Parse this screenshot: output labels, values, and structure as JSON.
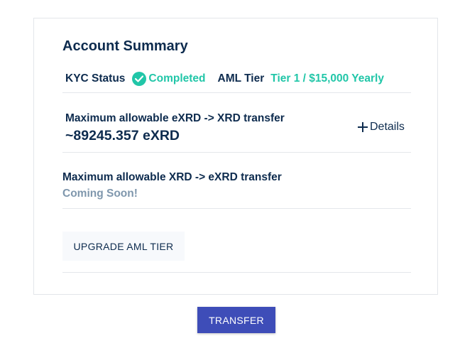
{
  "summary": {
    "title": "Account Summary",
    "kyc_label": "KYC Status",
    "kyc_value": "Completed",
    "aml_label": "AML Tier",
    "aml_value": "Tier 1 / $15,000 Yearly"
  },
  "exrd_to_xrd": {
    "label": "Maximum allowable eXRD -> XRD transfer",
    "amount": "~89245.357 eXRD",
    "details_label": "Details"
  },
  "xrd_to_exrd": {
    "label": "Maximum allowable XRD -> eXRD transfer",
    "status": "Coming Soon!"
  },
  "actions": {
    "upgrade_label": "UPGRADE AML TIER",
    "transfer_label": "TRANSFER"
  },
  "colors": {
    "accent": "#21c6a8",
    "primary_button": "#3e4db8",
    "text": "#0d2b4e",
    "muted": "#7f97ad"
  },
  "icons": {
    "kyc": "check-circle-icon",
    "details": "plus-icon"
  }
}
